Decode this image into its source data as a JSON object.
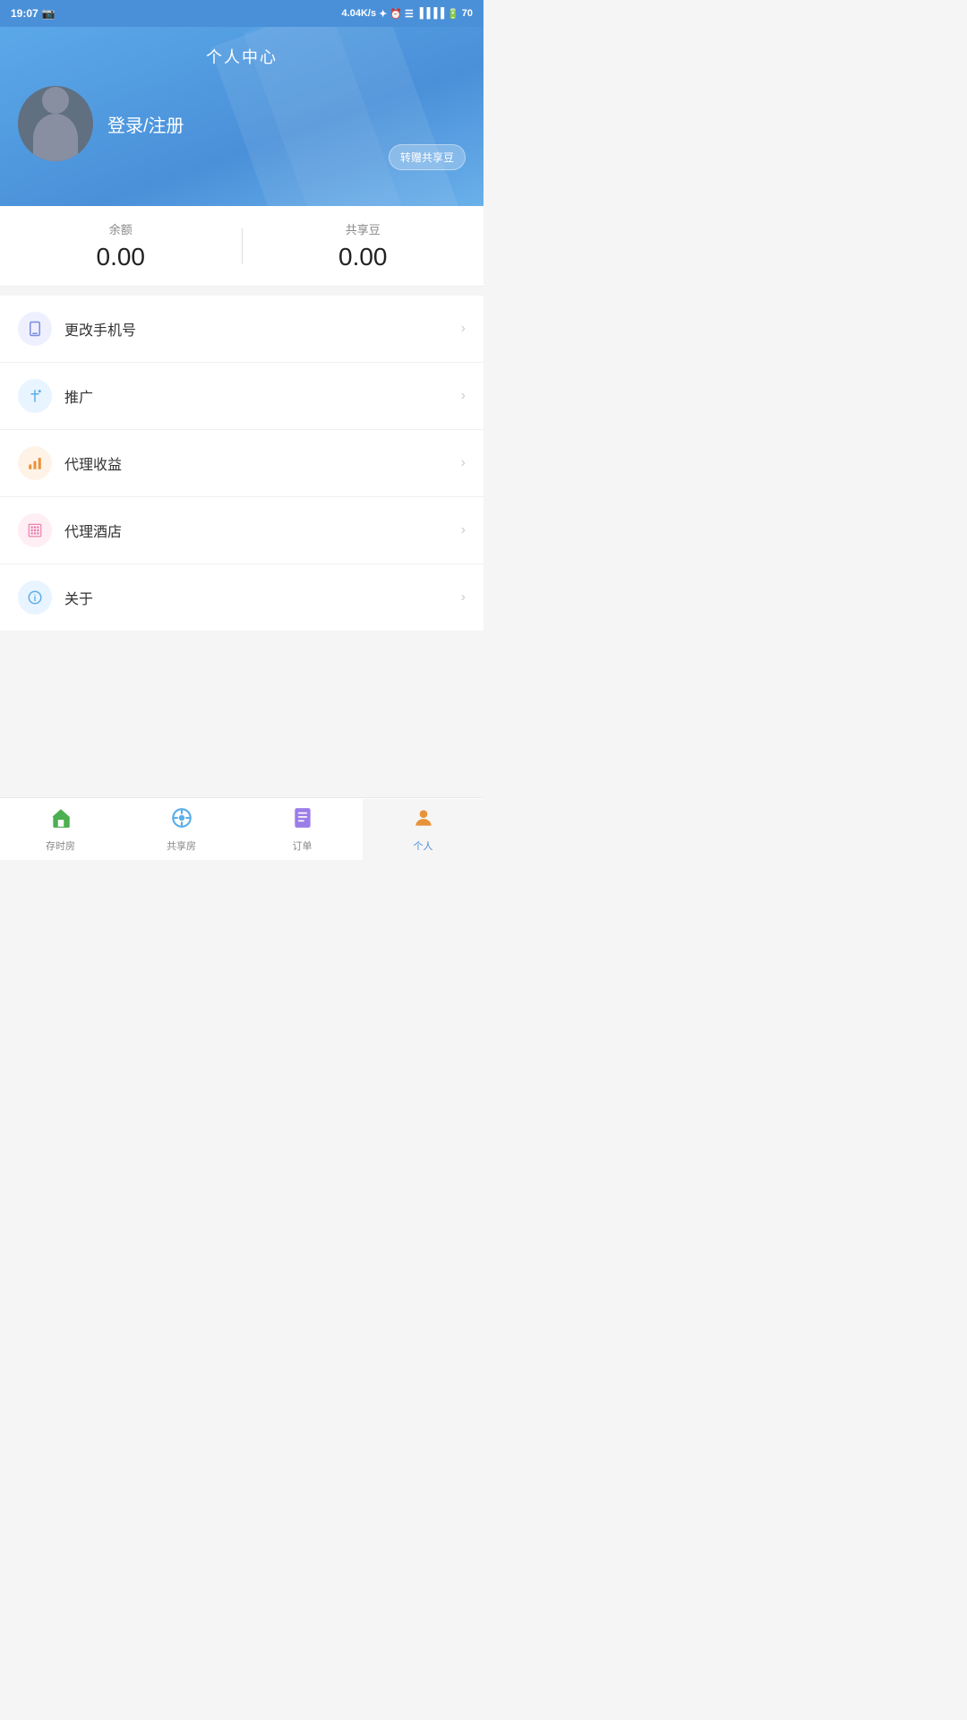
{
  "statusBar": {
    "time": "19:07",
    "speed": "4.04K/s",
    "battery": "70"
  },
  "header": {
    "title": "个人中心",
    "loginText": "登录/注册",
    "transferBtn": "转赠共享豆"
  },
  "balance": {
    "remainLabel": "余额",
    "remainValue": "0.00",
    "sharingLabel": "共享豆",
    "sharingValue": "0.00"
  },
  "menu": {
    "items": [
      {
        "id": "phone",
        "label": "更改手机号",
        "iconType": "phone"
      },
      {
        "id": "promo",
        "label": "推广",
        "iconType": "promo"
      },
      {
        "id": "earnings",
        "label": "代理收益",
        "iconType": "earnings"
      },
      {
        "id": "hotel",
        "label": "代理酒店",
        "iconType": "hotel"
      },
      {
        "id": "about",
        "label": "关于",
        "iconType": "about"
      }
    ]
  },
  "bottomNav": {
    "items": [
      {
        "id": "home",
        "label": "存时房",
        "active": false
      },
      {
        "id": "share",
        "label": "共享房",
        "active": false
      },
      {
        "id": "order",
        "label": "订单",
        "active": false
      },
      {
        "id": "profile",
        "label": "个人",
        "active": true
      }
    ]
  }
}
